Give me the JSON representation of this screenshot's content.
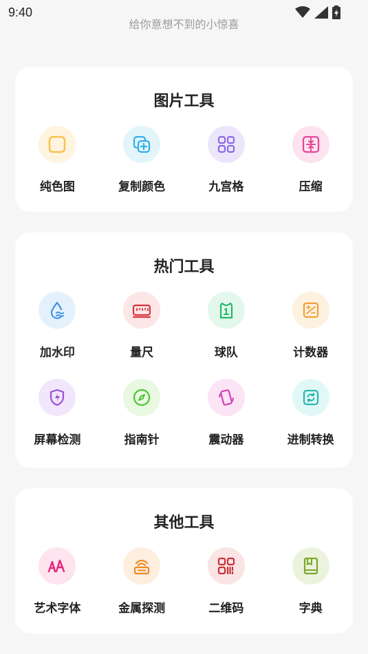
{
  "status": {
    "time": "9:40"
  },
  "subtitle": "给你意想不到的小惊喜",
  "sections": [
    {
      "title": "图片工具",
      "tools": [
        {
          "label": "纯色图",
          "icon": "square-icon"
        },
        {
          "label": "复制颜色",
          "icon": "copy-add-icon"
        },
        {
          "label": "九宫格",
          "icon": "grid-icon"
        },
        {
          "label": "压缩",
          "icon": "compress-icon"
        }
      ]
    },
    {
      "title": "热门工具",
      "tools": [
        {
          "label": "加水印",
          "icon": "water-drop-icon"
        },
        {
          "label": "量尺",
          "icon": "ruler-icon"
        },
        {
          "label": "球队",
          "icon": "jersey-icon"
        },
        {
          "label": "计数器",
          "icon": "counter-icon"
        },
        {
          "label": "屏幕检测",
          "icon": "shield-bolt-icon"
        },
        {
          "label": "指南针",
          "icon": "compass-icon"
        },
        {
          "label": "震动器",
          "icon": "vibrate-phone-icon"
        },
        {
          "label": "进制转换",
          "icon": "convert-icon"
        }
      ]
    },
    {
      "title": "其他工具",
      "tools": [
        {
          "label": "艺术字体",
          "icon": "art-font-icon"
        },
        {
          "label": "金属探测",
          "icon": "metal-detector-icon"
        },
        {
          "label": "二维码",
          "icon": "qrcode-icon"
        },
        {
          "label": "字典",
          "icon": "dictionary-icon"
        }
      ]
    }
  ]
}
